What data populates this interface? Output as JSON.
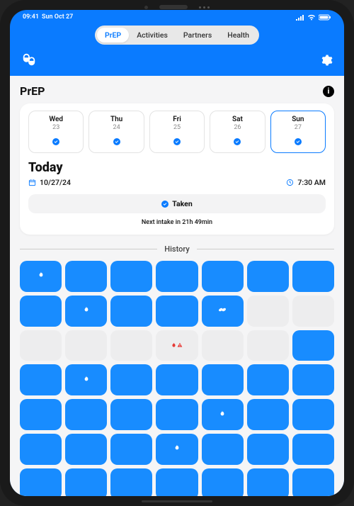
{
  "status": {
    "time": "09:41",
    "date": "Sun Oct 27"
  },
  "tabs": [
    {
      "label": "PrEP",
      "active": true
    },
    {
      "label": "Activities",
      "active": false
    },
    {
      "label": "Partners",
      "active": false
    },
    {
      "label": "Health",
      "active": false
    }
  ],
  "section": {
    "title": "PrEP"
  },
  "days": [
    {
      "name": "Wed",
      "num": "23",
      "checked": true,
      "selected": false
    },
    {
      "name": "Thu",
      "num": "24",
      "checked": true,
      "selected": false
    },
    {
      "name": "Fri",
      "num": "25",
      "checked": true,
      "selected": false
    },
    {
      "name": "Sat",
      "num": "26",
      "checked": true,
      "selected": false
    },
    {
      "name": "Sun",
      "num": "27",
      "checked": true,
      "selected": true
    }
  ],
  "today": {
    "heading": "Today",
    "date": "10/27/24",
    "time": "7:30 AM",
    "taken_label": "Taken",
    "next_intake": "Next intake in 21h 49min"
  },
  "history": {
    "label": "History",
    "cells": [
      {
        "t": "blue",
        "i": "flame"
      },
      {
        "t": "blue"
      },
      {
        "t": "blue"
      },
      {
        "t": "blue"
      },
      {
        "t": "blue"
      },
      {
        "t": "blue"
      },
      {
        "t": "blue"
      },
      {
        "t": "blue"
      },
      {
        "t": "blue",
        "i": "flame"
      },
      {
        "t": "blue"
      },
      {
        "t": "blue"
      },
      {
        "t": "blue",
        "i": "pills"
      },
      {
        "t": "grey"
      },
      {
        "t": "grey"
      },
      {
        "t": "grey"
      },
      {
        "t": "grey"
      },
      {
        "t": "grey"
      },
      {
        "t": "grey",
        "i": "flame-warn"
      },
      {
        "t": "grey"
      },
      {
        "t": "grey"
      },
      {
        "t": "blue"
      },
      {
        "t": "blue"
      },
      {
        "t": "blue",
        "i": "flame"
      },
      {
        "t": "blue"
      },
      {
        "t": "blue"
      },
      {
        "t": "blue"
      },
      {
        "t": "blue"
      },
      {
        "t": "blue"
      },
      {
        "t": "blue"
      },
      {
        "t": "blue"
      },
      {
        "t": "blue"
      },
      {
        "t": "blue"
      },
      {
        "t": "blue",
        "i": "flame"
      },
      {
        "t": "blue"
      },
      {
        "t": "blue"
      },
      {
        "t": "blue"
      },
      {
        "t": "blue"
      },
      {
        "t": "blue"
      },
      {
        "t": "blue",
        "i": "flame"
      },
      {
        "t": "blue"
      },
      {
        "t": "blue"
      },
      {
        "t": "blue"
      },
      {
        "t": "blue"
      },
      {
        "t": "blue"
      },
      {
        "t": "blue"
      },
      {
        "t": "blue"
      },
      {
        "t": "blue"
      },
      {
        "t": "blue"
      },
      {
        "t": "blue"
      }
    ]
  }
}
